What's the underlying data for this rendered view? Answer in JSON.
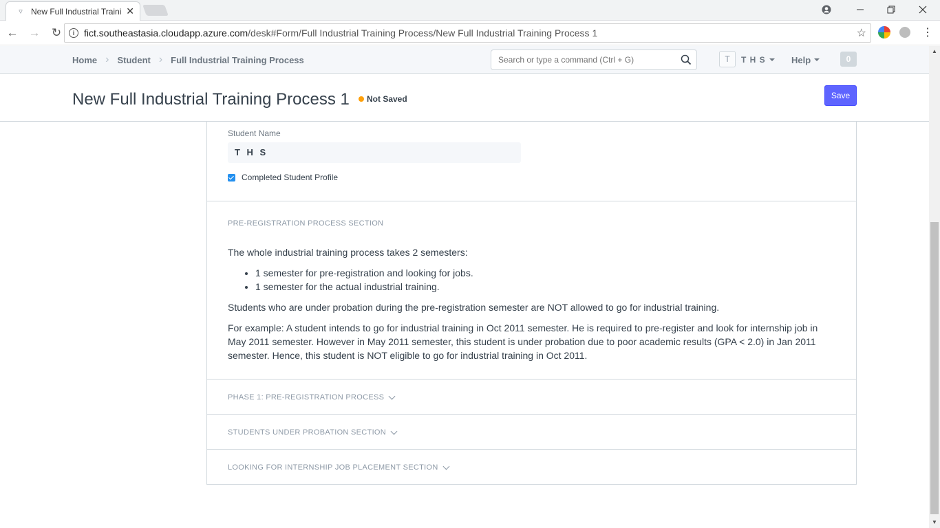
{
  "browser": {
    "tab_title": "New Full Industrial Training Process 1",
    "url_host": "fict.southeastasia.cloudapp.azure.com",
    "url_path": "/desk#Form/Full Industrial Training Process/New Full Industrial Training Process 1"
  },
  "navbar": {
    "breadcrumbs": [
      "Home",
      "Student",
      "Full Industrial Training Process"
    ],
    "search_placeholder": "Search or type a command (Ctrl + G)",
    "avatar_letter": "T",
    "user_name": "T H S",
    "help_label": "Help",
    "notification_count": "0"
  },
  "page": {
    "title": "New Full Industrial Training Process 1",
    "status": "Not Saved",
    "save_label": "Save"
  },
  "form": {
    "student_name_label": "Student Name",
    "student_name_value": "T H S",
    "completed_profile_label": "Completed Student Profile",
    "sections": {
      "pre_registration": {
        "heading": "PRE-REGISTRATION PROCESS SECTION",
        "intro": "The whole industrial training process takes 2 semesters:",
        "bullets": [
          "1 semester for pre-registration and looking for jobs.",
          "1 semester for the actual industrial training."
        ],
        "para1": "Students who are under probation during the pre-registration semester are NOT allowed to go for industrial training.",
        "para2": "For example: A student intends to go for industrial training in Oct 2011 semester. He is required to pre-register and look for internship job in May 2011 semester. However in May 2011 semester, this student is under probation due to poor academic results (GPA < 2.0) in Jan 2011 semester. Hence, this student is NOT eligible to go for industrial training in Oct 2011."
      },
      "phase1": {
        "heading": "PHASE 1: PRE-REGISTRATION PROCESS"
      },
      "probation": {
        "heading": "STUDENTS UNDER PROBATION SECTION"
      },
      "internship": {
        "heading": "LOOKING FOR INTERNSHIP JOB PLACEMENT SECTION"
      }
    }
  },
  "colors": {
    "primary": "#5e64ff",
    "indicator_orange": "#ffa00a",
    "checkbox_blue": "#2490ef"
  }
}
